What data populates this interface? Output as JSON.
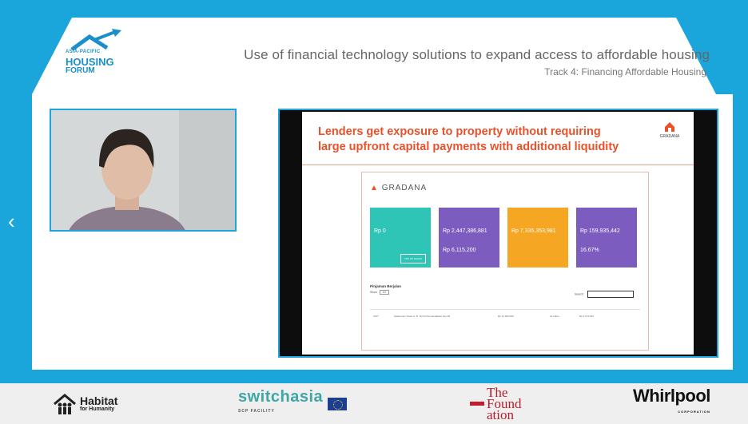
{
  "header": {
    "logo_small": "ASIA-PACIFIC",
    "logo_housing": "HOUSING",
    "logo_forum": "FORUM",
    "title": "Use of financial technology solutions to expand access to affordable housing",
    "subtitle": "Track 4: Financing Affordable Housing"
  },
  "nav": {
    "prev_icon": "chevron-left-icon"
  },
  "slide": {
    "title": "Lenders get exposure to property without requiring large upfront capital payments with additional liquidity",
    "brand": "GRADANA",
    "app": {
      "logo": "GRADANA",
      "cards": [
        {
          "color": "#2ec4b6",
          "value": "Rp 0",
          "button": "TOP UP SALDO"
        },
        {
          "color": "#7c5cbf",
          "value": "Rp 2,447,386,881",
          "value2": "Rp 6,115,200"
        },
        {
          "color": "#f5a623",
          "value": "Rp 7,335,353,981"
        },
        {
          "color": "#7c5cbf",
          "value": "Rp 159,935,442",
          "value2": "16.67%"
        }
      ],
      "table_title": "Pinjaman Berjalan",
      "show_label": "Show",
      "show_value": "10",
      "search_label": "Search:",
      "row": {
        "c1": "UNIT",
        "c2": "Apartemen Tower A, B, Terr1st Kemandalaan Kec.69",
        "c3": "Rp 21,960,000",
        "c4": "12 bulan",
        "c5": "Rp 4,074,542"
      }
    }
  },
  "footer": {
    "habitat": "Habitat",
    "habitat_sub": "for Humanity",
    "switch": "switchasia",
    "switch_sub": "SCP FACILITY",
    "foundation": "The Found ation",
    "whirlpool": "Whirlpool",
    "whirlpool_sub": "CORPORATION"
  },
  "colors": {
    "accent": "#1aa6db",
    "slide_title": "#e8512a"
  }
}
